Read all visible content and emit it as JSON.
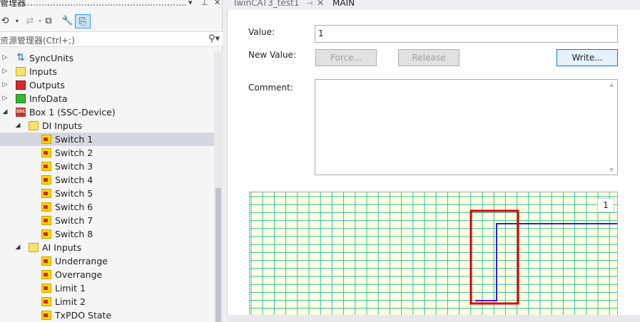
{
  "explorer": {
    "title": "管理器",
    "search_placeholder": "资源管理器(Ctrl+;)",
    "tree": [
      {
        "label": "SyncUnits",
        "icon": "sync-icon",
        "level": 0,
        "expander": "▷"
      },
      {
        "label": "Inputs",
        "icon": "folder-icon",
        "level": 0,
        "expander": "▷"
      },
      {
        "label": "Outputs",
        "icon": "outputs-icon",
        "level": 0,
        "expander": "▷"
      },
      {
        "label": "InfoData",
        "icon": "infodata-icon",
        "level": 0,
        "expander": "▷"
      },
      {
        "label": "Box 1 (SSC-Device)",
        "icon": "ssc-device-icon",
        "level": 0,
        "expander": "◢"
      },
      {
        "label": "DI Inputs",
        "icon": "folder-icon",
        "level": 1,
        "expander": "◢"
      },
      {
        "label": "Switch 1",
        "icon": "variable-icon",
        "level": 2,
        "expander": "",
        "selected": true
      },
      {
        "label": "Switch 2",
        "icon": "variable-icon",
        "level": 2,
        "expander": ""
      },
      {
        "label": "Switch 3",
        "icon": "variable-icon",
        "level": 2,
        "expander": ""
      },
      {
        "label": "Switch 4",
        "icon": "variable-icon",
        "level": 2,
        "expander": ""
      },
      {
        "label": "Switch 5",
        "icon": "variable-icon",
        "level": 2,
        "expander": ""
      },
      {
        "label": "Switch 6",
        "icon": "variable-icon",
        "level": 2,
        "expander": ""
      },
      {
        "label": "Switch 7",
        "icon": "variable-icon",
        "level": 2,
        "expander": ""
      },
      {
        "label": "Switch 8",
        "icon": "variable-icon",
        "level": 2,
        "expander": ""
      },
      {
        "label": "AI Inputs",
        "icon": "folder-icon",
        "level": 1,
        "expander": "◢"
      },
      {
        "label": "Underrange",
        "icon": "variable-icon",
        "level": 2,
        "expander": ""
      },
      {
        "label": "Overrange",
        "icon": "variable-icon",
        "level": 2,
        "expander": ""
      },
      {
        "label": "Limit 1",
        "icon": "variable-icon",
        "level": 2,
        "expander": ""
      },
      {
        "label": "Limit 2",
        "icon": "variable-icon",
        "level": 2,
        "expander": ""
      },
      {
        "label": "TxPDO State",
        "icon": "variable-icon",
        "level": 2,
        "expander": ""
      }
    ]
  },
  "tabs": {
    "tab1": "TwinCAT3_test1",
    "tab2": "MAIN"
  },
  "form": {
    "value_label": "Value:",
    "value": "1",
    "new_value_label": "New Value:",
    "force_label": "Force...",
    "release_label": "Release",
    "write_label": "Write...",
    "comment_label": "Comment:",
    "comment": ""
  },
  "chart_data": {
    "type": "line",
    "series": [
      {
        "values": [
          [
            0,
            0
          ],
          [
            1,
            0
          ],
          [
            1,
            1
          ],
          [
            2,
            1
          ]
        ]
      }
    ],
    "ylim": [
      0,
      1
    ],
    "grid": true,
    "badge": "1",
    "line_color": "#3a1ccf",
    "highlight_color": "#e00000"
  },
  "colors": {
    "accent": "#0078d7",
    "grid": "#2fbfa9",
    "chart_bg": "#fffee1"
  }
}
